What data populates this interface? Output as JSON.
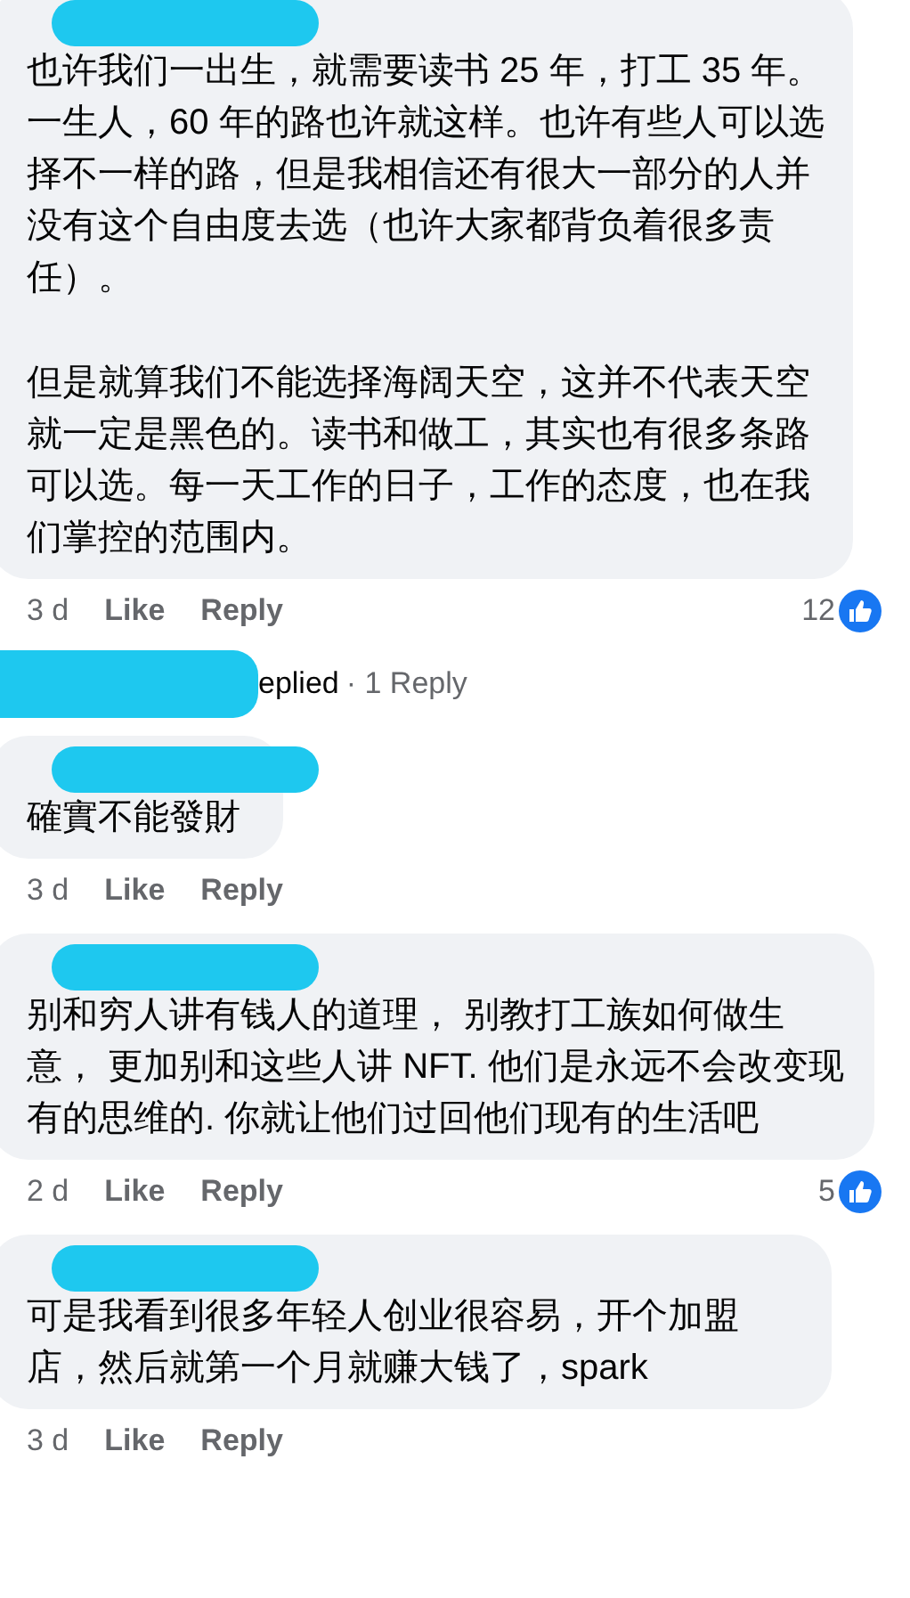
{
  "comments": [
    {
      "paragraphs": [
        "也许我们一出生，就需要读书 25 年，打工 35 年。一生人，60 年的路也许就这样。也许有些人可以选择不一样的路，但是我相信还有很大一部分的人并没有这个自由度去选（也许大家都背负着很多责任）。",
        "但是就算我们不能选择海阔天空，这并不代表天空就一定是黑色的。读书和做工，其实也有很多条路可以选。每一天工作的日子，工作的态度，也在我们掌控的范围内。"
      ],
      "time": "3 d",
      "like": "Like",
      "reply": "Reply",
      "reactions": "12",
      "replies": {
        "text": "eplied",
        "count": "· 1 Reply"
      }
    },
    {
      "paragraphs": [
        "確實不能發財"
      ],
      "time": "3 d",
      "like": "Like",
      "reply": "Reply"
    },
    {
      "paragraphs": [
        "别和穷人讲有钱人的道理， 别教打工族如何做生意， 更加别和这些人讲 NFT. 他们是永远不会改变现有的思维的. 你就让他们过回他们现有的生活吧"
      ],
      "time": "2 d",
      "like": "Like",
      "reply": "Reply",
      "reactions": "5"
    },
    {
      "paragraphs": [
        "可是我看到很多年轻人创业很容易，开个加盟店，然后就第一个月就赚大钱了，spark"
      ],
      "time": "3 d",
      "like": "Like",
      "reply": "Reply"
    }
  ]
}
